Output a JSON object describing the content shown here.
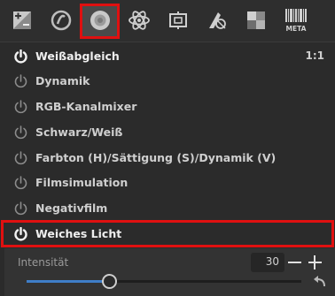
{
  "toolbar": {
    "tabs": [
      {
        "icon": "exposure-icon"
      },
      {
        "icon": "detail-icon"
      },
      {
        "icon": "color-icon",
        "active": true
      },
      {
        "icon": "advanced-icon"
      },
      {
        "icon": "transform-icon"
      },
      {
        "icon": "raw-icon"
      },
      {
        "icon": "locallab-icon"
      },
      {
        "icon": "meta-icon",
        "text": "META"
      }
    ]
  },
  "panel": {
    "items": [
      {
        "label": "Weißabgleich",
        "enabled": true,
        "extra": "1:1"
      },
      {
        "label": "Dynamik",
        "enabled": false
      },
      {
        "label": "RGB-Kanalmixer",
        "enabled": false
      },
      {
        "label": "Schwarz/Weiß",
        "enabled": false
      },
      {
        "label": "Farbton (H)/Sättigung (S)/Dynamik (V)",
        "enabled": false
      },
      {
        "label": "Filmsimulation",
        "enabled": false
      },
      {
        "label": "Negativfilm",
        "enabled": false
      },
      {
        "label": "Weiches Licht",
        "enabled": true
      }
    ]
  },
  "soft_light": {
    "strength_label": "Intensität",
    "strength_value": "30",
    "slider_fraction": 0.3
  },
  "colors": {
    "highlight": "#e01010",
    "slider_fill": "#3f7ec8"
  }
}
